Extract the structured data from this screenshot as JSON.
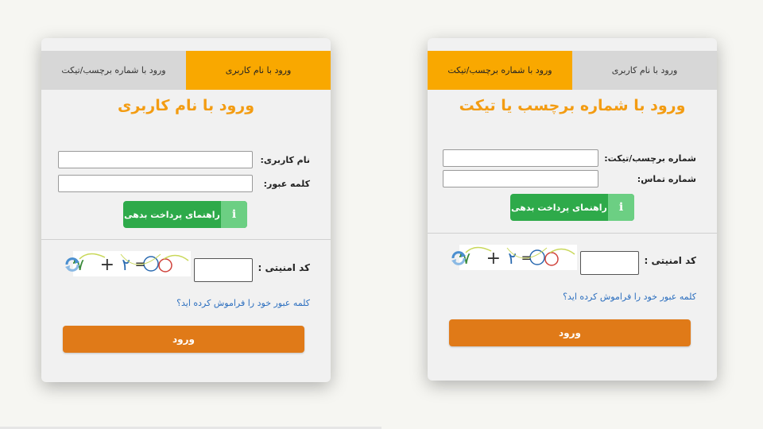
{
  "left_form": {
    "tabs": [
      {
        "label": "ورود با نام کاربری",
        "active": true
      },
      {
        "label": "ورود با شماره برچسب/تیکت",
        "active": false
      }
    ],
    "title": "ورود با نام کاربری",
    "fields": [
      {
        "label": "نام کاربری:",
        "value": ""
      },
      {
        "label": "کلمه عبور:",
        "value": ""
      }
    ],
    "help_button": {
      "label": "راهنمای پرداخت بدهی",
      "icon": "info-icon"
    },
    "captcha": {
      "label": "کد امنیتی :",
      "value": ""
    },
    "forgot_link": "کلمه عبور خود را فراموش کرده اید؟",
    "submit_label": "ورود"
  },
  "right_form": {
    "tabs": [
      {
        "label": "ورود با شماره برچسب/تیکت",
        "active": true
      },
      {
        "label": "ورود با نام کاربری",
        "active": false
      }
    ],
    "title": "ورود با شماره برچسب یا تیکت",
    "fields": [
      {
        "label": "شماره برچسب/تیکت:",
        "value": ""
      },
      {
        "label": "شماره تماس:",
        "value": ""
      }
    ],
    "help_button": {
      "label": "راهنمای پرداخت بدهی",
      "icon": "info-icon"
    },
    "captcha": {
      "label": "کد امنیتی :",
      "value": ""
    },
    "forgot_link": "کلمه عبور خود را فراموش کرده اید؟",
    "submit_label": "ورود"
  },
  "colors": {
    "accent_orange": "#f9a800",
    "title_orange": "#f39c12",
    "submit_orange": "#e07a18",
    "help_green": "#2eaa4a",
    "link_blue": "#2c6fbf"
  }
}
